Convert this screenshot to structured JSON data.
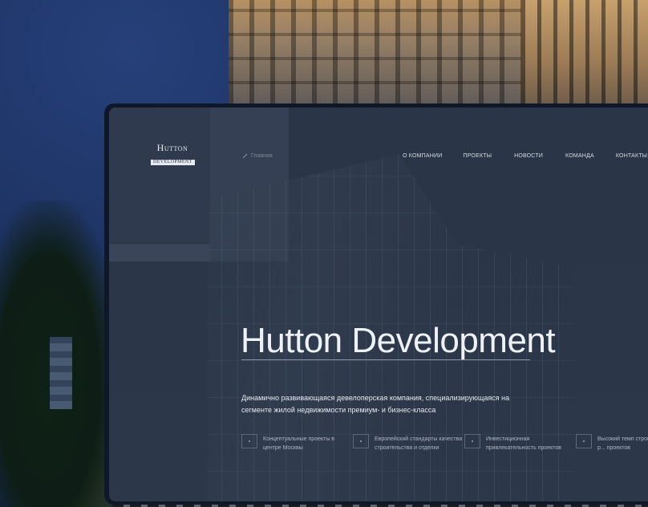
{
  "site": {
    "logo": {
      "main": "Hutton",
      "sub": "DEVELOPMENT"
    },
    "breadcrumb": {
      "home": "Главная"
    },
    "nav": [
      "О КОМПАНИИ",
      "ПРОЕКТЫ",
      "НОВОСТИ",
      "КОМАНДА",
      "КОНТАКТЫ"
    ],
    "hero": {
      "title": "Hutton Development",
      "description": "Динамично развивающаяся девелоперская компания, специализирующаяся на сегменте жилой недвижимости премиум- и бизнес-класса"
    },
    "features": [
      {
        "text": "Концептуальные проекты в центре Москвы"
      },
      {
        "text": "Европейский стандарты качества строительства и отделки"
      },
      {
        "text": "Инвестиционная привлекательность проектов"
      },
      {
        "text": "Высокий темп строительства и р... проектов"
      }
    ]
  },
  "colors": {
    "site_bg": "#2a3548",
    "text_light": "#eef1f6",
    "text_muted": "#aeb6c4"
  }
}
